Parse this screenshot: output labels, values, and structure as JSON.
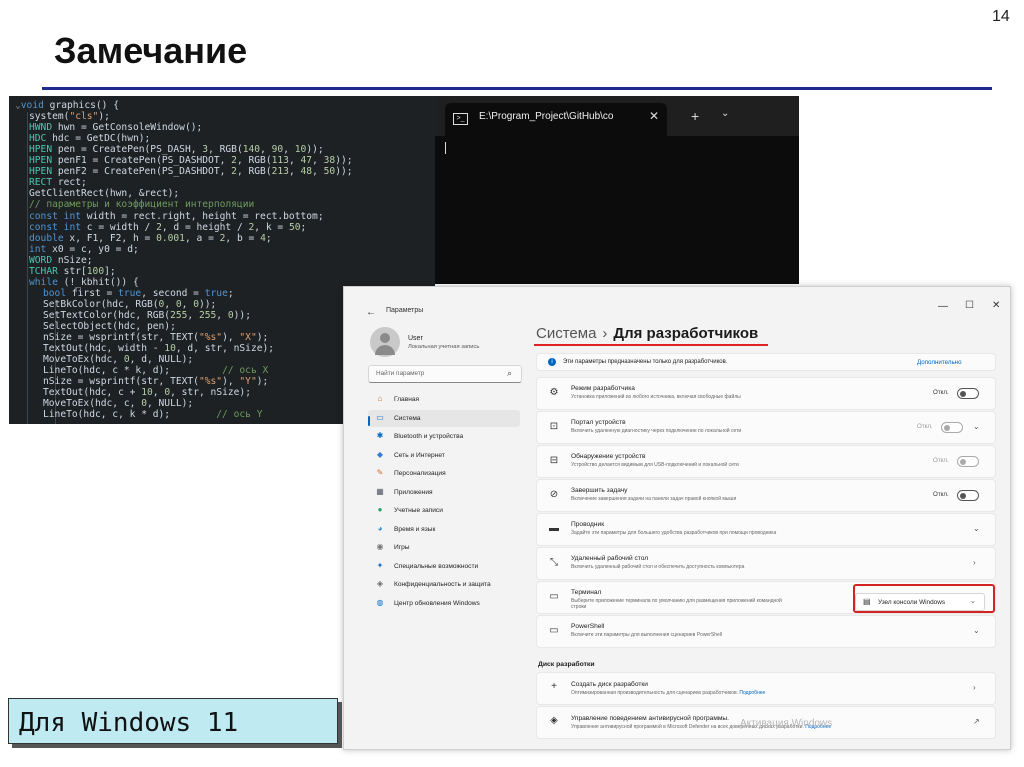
{
  "slide": {
    "number": "14",
    "title": "Замечание",
    "caption": "Для Windows 11"
  },
  "code": {
    "lines": [
      {
        "i": 0,
        "t": "void graphics() {"
      },
      {
        "i": 1,
        "t": "system(\"cls\");"
      },
      {
        "i": 1,
        "t": "HWND hwn = GetConsoleWindow();"
      },
      {
        "i": 1,
        "t": "HDC hdc = GetDC(hwn);"
      },
      {
        "i": 1,
        "t": "HPEN pen = CreatePen(PS_DASH, 3, RGB(140, 90, 10));"
      },
      {
        "i": 1,
        "t": "HPEN penF1 = CreatePen(PS_DASHDOT, 2, RGB(113, 47, 38));"
      },
      {
        "i": 1,
        "t": "HPEN penF2 = CreatePen(PS_DASHDOT, 2, RGB(213, 48, 50));"
      },
      {
        "i": 1,
        "t": "RECT rect;"
      },
      {
        "i": 1,
        "t": "GetClientRect(hwn, &rect);"
      },
      {
        "i": 1,
        "t": "// параметры и коэффициент интерполяции"
      },
      {
        "i": 1,
        "t": "const int width = rect.right, height = rect.bottom;"
      },
      {
        "i": 1,
        "t": "const int c = width / 2, d = height / 2, k = 50;"
      },
      {
        "i": 1,
        "t": "double x, F1, F2, h = 0.001, a = 2, b = 4;"
      },
      {
        "i": 1,
        "t": "int x0 = c, y0 = d;"
      },
      {
        "i": 1,
        "t": "WORD nSize;"
      },
      {
        "i": 1,
        "t": "TCHAR str[100];"
      },
      {
        "i": 1,
        "t": "while (!_kbhit()) {"
      },
      {
        "i": 2,
        "t": "bool first = true, second = true;"
      },
      {
        "i": 2,
        "t": "SetBkColor(hdc, RGB(0, 0, 0));"
      },
      {
        "i": 2,
        "t": "SetTextColor(hdc, RGB(255, 255, 0));"
      },
      {
        "i": 2,
        "t": "SelectObject(hdc, pen);"
      },
      {
        "i": 2,
        "t": "nSize = wsprintf(str, TEXT(\"%s\"), \"X\");"
      },
      {
        "i": 2,
        "t": "TextOut(hdc, width - 10, d, str, nSize);"
      },
      {
        "i": 2,
        "t": "MoveToEx(hdc, 0, d, NULL);"
      },
      {
        "i": 2,
        "t": "LineTo(hdc, c * k, d);         // ось X"
      },
      {
        "i": 2,
        "t": "nSize = wsprintf(str, TEXT(\"%s\"), \"Y\");"
      },
      {
        "i": 2,
        "t": "TextOut(hdc, c + 10, 0, str, nSize);"
      },
      {
        "i": 2,
        "t": "MoveToEx(hdc, c, 0, NULL);"
      },
      {
        "i": 2,
        "t": "LineTo(hdc, c, k * d);        // ось Y"
      }
    ]
  },
  "terminal": {
    "tab_title": "E:\\Program_Project\\GitHub\\co",
    "tab_icon": "terminal-icon",
    "close_label": "✕",
    "new_tab_label": "+",
    "dropdown_label": "⌄"
  },
  "settings": {
    "window_title": "Параметры",
    "user": {
      "name": "User",
      "subtitle": "Локальная учетная запись"
    },
    "search_placeholder": "Найти параметр",
    "nav": [
      {
        "label": "Главная",
        "icon": "home-icon",
        "glyph": "⌂",
        "color": "#c0702a"
      },
      {
        "label": "Система",
        "icon": "monitor-icon",
        "glyph": "▭",
        "color": "#0067c0",
        "active": true
      },
      {
        "label": "Bluetooth и устройства",
        "icon": "bluetooth-icon",
        "glyph": "✱",
        "color": "#0067c0"
      },
      {
        "label": "Сеть и Интернет",
        "icon": "wifi-icon",
        "glyph": "◆",
        "color": "#3a7bd5"
      },
      {
        "label": "Персонализация",
        "icon": "brush-icon",
        "glyph": "✎",
        "color": "#d86b2a"
      },
      {
        "label": "Приложения",
        "icon": "apps-icon",
        "glyph": "▦",
        "color": "#556"
      },
      {
        "label": "Учетные записи",
        "icon": "person-icon",
        "glyph": "●",
        "color": "#2aa36b"
      },
      {
        "label": "Время и язык",
        "icon": "globe-icon",
        "glyph": "◕",
        "color": "#2a8fd8"
      },
      {
        "label": "Игры",
        "icon": "gamepad-icon",
        "glyph": "◉",
        "color": "#777"
      },
      {
        "label": "Специальные возможности",
        "icon": "accessibility-icon",
        "glyph": "✦",
        "color": "#1b6fc4"
      },
      {
        "label": "Конфиденциальность и защита",
        "icon": "shield-icon",
        "glyph": "◈",
        "color": "#666"
      },
      {
        "label": "Центр обновления Windows",
        "icon": "update-icon",
        "glyph": "◍",
        "color": "#0a6fd0"
      }
    ],
    "breadcrumb": {
      "parent": "Система",
      "separator": "›",
      "current": "Для разработчиков"
    },
    "info": {
      "text": "Эти параметры предназначены только для разработчиков.",
      "link": "Дополнительно"
    },
    "cards": [
      {
        "name": "developer-mode",
        "icon": "tool-icon",
        "glyph": "⚙",
        "title": "Режим разработчика",
        "subtitle": "Установка приложений из любого источника, включая свободные файлы",
        "state": "Откл.",
        "toggle": true,
        "dim": false,
        "chevron": ""
      },
      {
        "name": "device-portal",
        "icon": "portal-icon",
        "glyph": "⊡",
        "title": "Портал устройств",
        "subtitle": "Включить удаленную диагностику через подключение по локальной сети",
        "state": "Откл.",
        "toggle": true,
        "dim": true,
        "chevron": "⌄"
      },
      {
        "name": "device-discovery",
        "icon": "discovery-icon",
        "glyph": "⊟",
        "title": "Обнаружение устройств",
        "subtitle": "Устройство делается видимым для USB-подключений и локальной сети",
        "state": "Откл.",
        "toggle": true,
        "dim": true,
        "chevron": ""
      },
      {
        "name": "end-task",
        "icon": "end-task-icon",
        "glyph": "⊘",
        "title": "Завершить задачу",
        "subtitle": "Включение завершения задачи на панели задач правой кнопкой мыши",
        "state": "Откл.",
        "toggle": true,
        "dim": false,
        "chevron": ""
      },
      {
        "name": "explorer",
        "icon": "folder-icon",
        "glyph": "▬",
        "title": "Проводник",
        "subtitle": "Задайте эти параметры для большего удобства разработчиков при помощи проводника",
        "state": "",
        "toggle": false,
        "dim": false,
        "chevron": "⌄"
      },
      {
        "name": "remote-desktop",
        "icon": "remote-icon",
        "glyph": "⤡",
        "title": "Удаленный рабочий стол",
        "subtitle": "Включить удаленный рабочий стол и обеспечить доступность компьютера",
        "state": "",
        "toggle": false,
        "dim": false,
        "chevron": "›"
      },
      {
        "name": "terminal",
        "icon": "terminal-icon",
        "glyph": "▭",
        "title": "Терминал",
        "subtitle": "Выберите приложение терминала по умолчанию для размещения приложений командной",
        "subtitle2": "строки",
        "state": "",
        "toggle": false,
        "dim": false,
        "chevron": ""
      },
      {
        "name": "powershell",
        "icon": "powershell-icon",
        "glyph": "▭",
        "title": "PowerShell",
        "subtitle": "Включите эти параметры для выполнения сценариев PowerShell",
        "state": "",
        "toggle": false,
        "dim": false,
        "chevron": "⌄"
      }
    ],
    "terminal_dropdown": {
      "value": "Узел консоли Windows",
      "icon": "console-icon",
      "glyph": "▤",
      "chevron": "⌄"
    },
    "section_title": "Диск разработки",
    "dev_drive": [
      {
        "name": "create-dev-drive",
        "icon": "plus-icon",
        "glyph": "+",
        "title": "Создать диск разработки",
        "subtitle": "Оптимизированная производительность для сценариев разработчиков.",
        "link": "Подробнее",
        "chevron": "›"
      },
      {
        "name": "antivirus",
        "icon": "shield-icon",
        "glyph": "◈",
        "title": "Управление поведением антивирусной программы.",
        "subtitle": "Управление антивирусной программой в Microsoft Defender на всех доверенных дисках разработки.",
        "link": "Подробнее",
        "chevron": "↗"
      }
    ],
    "watermark": "Активация Windows"
  }
}
